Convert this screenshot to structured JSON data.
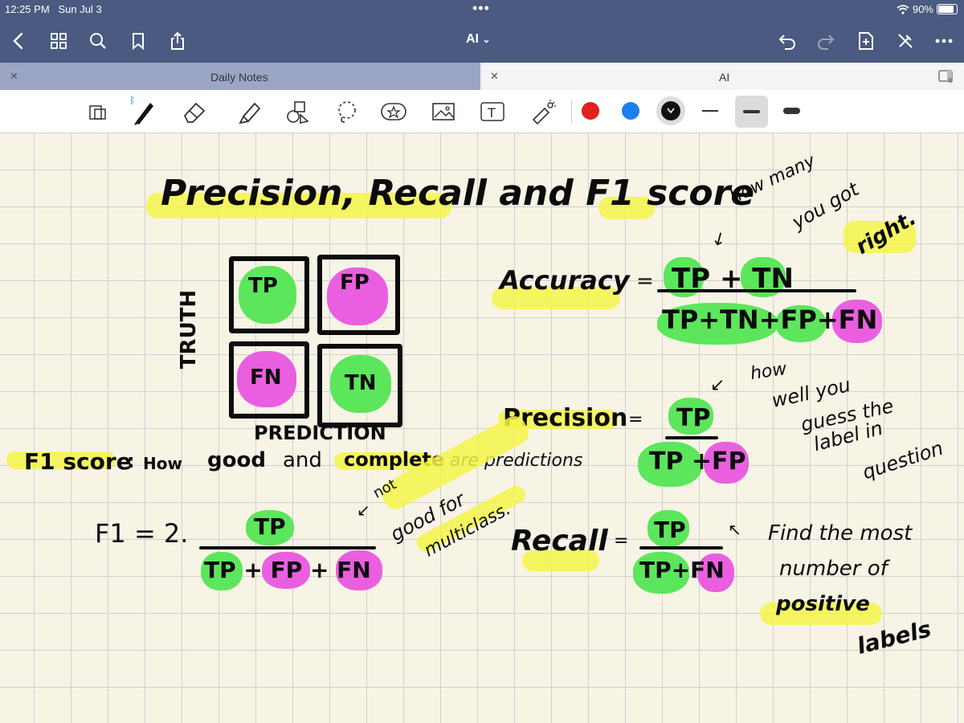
{
  "status_bar": {
    "time": "12:25 PM",
    "date": "Sun Jul 3",
    "battery": "90%"
  },
  "nav": {
    "title": "AI",
    "chevron": "⌄"
  },
  "tabs": [
    {
      "label": "Daily Notes"
    },
    {
      "label": "AI"
    }
  ],
  "toolbar": {
    "colors": [
      "#e0211d",
      "#1e7ef0",
      "#111111"
    ]
  },
  "notes": {
    "title": "Precision, Recall and F1 score",
    "matrix": {
      "truth_label": "TRUTH",
      "prediction_label": "PREDICTION",
      "tp": "TP",
      "fp": "FP",
      "fn": "FN",
      "tn": "TN"
    },
    "accuracy": {
      "label": "Accuracy",
      "eq": "=",
      "numerator": "TP + TN",
      "denominator": "TP+TN+FP+FN",
      "note": [
        "how many",
        "you got",
        "right."
      ]
    },
    "precision": {
      "label": "Precision",
      "eq": "=",
      "numerator": "TP",
      "denominator": "TP +FP",
      "note": [
        "how",
        "well you",
        "guess the",
        "label in",
        "question"
      ]
    },
    "f1": {
      "label": "F1 score",
      "desc_colon": ":",
      "desc": [
        "How",
        "good",
        "and",
        "complete",
        "are predictions"
      ],
      "formula_lhs": "F1 = 2.",
      "numerator": "TP",
      "denominator": "TP + FP + FN",
      "note": [
        "not",
        "good for",
        "multiclass."
      ]
    },
    "recall": {
      "label": "Recall",
      "eq": "=",
      "numerator": "TP",
      "denominator": "TP+FN",
      "note": [
        "Find the most",
        "number of",
        "positive",
        "labels"
      ]
    }
  }
}
